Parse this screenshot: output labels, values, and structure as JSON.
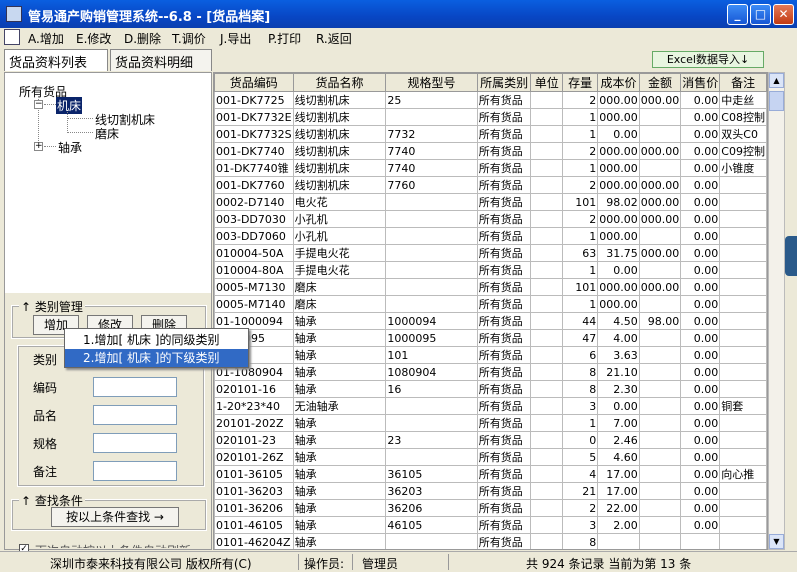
{
  "window": {
    "title": "管易通产购销管理系统--6.8 - [货品档案]",
    "min": "_",
    "max": "□",
    "close": "✕"
  },
  "menu": [
    "A.增加",
    "E.修改",
    "D.删除",
    "T.调价",
    "J.导出",
    "P.打印",
    "R.返回"
  ],
  "tabs": [
    "货品资料列表",
    "货品资料明细"
  ],
  "excel_button": "Excel数据导入↓",
  "tree": {
    "root": "所有货品",
    "nodes": [
      "机床",
      "线切割机床",
      "磨床",
      "轴承"
    ]
  },
  "category": {
    "title": "类别管理",
    "add": "增加",
    "edit": "修改",
    "delete": "删除"
  },
  "popup": [
    "1.增加[ 机床 ]的同级类别",
    "2.增加[ 机床 ]的下级类别"
  ],
  "form": {
    "labels": [
      "类别",
      "编码",
      "品名",
      "规格",
      "备注"
    ]
  },
  "search": {
    "title": "查找条件",
    "button": "按以上条件查找 →",
    "checkbox_label": "下次自动按以上条件自动刷新"
  },
  "table": {
    "headers": [
      "货品编码",
      "货品名称",
      "规格型号",
      "所属类别",
      "单位",
      "存量",
      "成本价",
      "金额",
      "消售价",
      "备注"
    ],
    "rows": [
      [
        "001-DK7725",
        "线切割机床",
        "25",
        "所有货品",
        "",
        "2",
        "000.00",
        "000.00",
        "0.00",
        "中走丝"
      ],
      [
        "001-DK7732E",
        "线切割机床",
        "",
        "所有货品",
        "",
        "1",
        "000.00",
        "",
        "0.00",
        "C08控制"
      ],
      [
        "001-DK7732S",
        "线切割机床",
        "7732",
        "所有货品",
        "",
        "1",
        "0.00",
        "",
        "0.00",
        "双头C0"
      ],
      [
        "001-DK7740",
        "线切割机床",
        "7740",
        "所有货品",
        "",
        "2",
        "000.00",
        "000.00",
        "0.00",
        "C09控制"
      ],
      [
        "01-DK7740锥",
        "线切割机床",
        "7740",
        "所有货品",
        "",
        "1",
        "000.00",
        "",
        "0.00",
        "小锥度"
      ],
      [
        "001-DK7760",
        "线切割机床",
        "7760",
        "所有货品",
        "",
        "2",
        "000.00",
        "000.00",
        "0.00",
        ""
      ],
      [
        "0002-D7140",
        "电火花",
        "",
        "所有货品",
        "",
        "101",
        "98.02",
        "000.00",
        "0.00",
        ""
      ],
      [
        "003-DD7030",
        "小孔机",
        "",
        "所有货品",
        "",
        "2",
        "000.00",
        "000.00",
        "0.00",
        ""
      ],
      [
        "003-DD7060",
        "小孔机",
        "",
        "所有货品",
        "",
        "1",
        "000.00",
        "",
        "0.00",
        ""
      ],
      [
        "010004-50A",
        "手提电火花",
        "",
        "所有货品",
        "",
        "63",
        "31.75",
        "000.00",
        "0.00",
        ""
      ],
      [
        "010004-80A",
        "手提电火花",
        "",
        "所有货品",
        "",
        "1",
        "0.00",
        "",
        "0.00",
        ""
      ],
      [
        "0005-M7130",
        "磨床",
        "",
        "所有货品",
        "",
        "101",
        "000.00",
        "000.00",
        "0.00",
        ""
      ],
      [
        "0005-M7140",
        "磨床",
        "",
        "所有货品",
        "",
        "1",
        "000.00",
        "",
        "0.00",
        ""
      ],
      [
        "01-1000094",
        "轴承",
        "1000094",
        "所有货品",
        "",
        "44",
        "4.50",
        "98.00",
        "0.00",
        ""
      ],
      [
        "1000095",
        "轴承",
        "1000095",
        "所有货品",
        "",
        "47",
        "4.00",
        "",
        "0.00",
        ""
      ],
      [
        "-101",
        "轴承",
        "101",
        "所有货品",
        "",
        "6",
        "3.63",
        "",
        "0.00",
        ""
      ],
      [
        "01-1080904",
        "轴承",
        "1080904",
        "所有货品",
        "",
        "8",
        "21.10",
        "",
        "0.00",
        ""
      ],
      [
        "020101-16",
        "轴承",
        "16",
        "所有货品",
        "",
        "8",
        "2.30",
        "",
        "0.00",
        ""
      ],
      [
        "1-20*23*40",
        "无油轴承",
        "",
        "所有货品",
        "",
        "3",
        "0.00",
        "",
        "0.00",
        "铜套"
      ],
      [
        "20101-202Z",
        "轴承",
        "",
        "所有货品",
        "",
        "1",
        "7.00",
        "",
        "0.00",
        ""
      ],
      [
        "020101-23",
        "轴承",
        "23",
        "所有货品",
        "",
        "0",
        "2.46",
        "",
        "0.00",
        ""
      ],
      [
        "020101-26Z",
        "轴承",
        "",
        "所有货品",
        "",
        "5",
        "4.60",
        "",
        "0.00",
        ""
      ],
      [
        "0101-36105",
        "轴承",
        "36105",
        "所有货品",
        "",
        "4",
        "17.00",
        "",
        "0.00",
        "向心推"
      ],
      [
        "0101-36203",
        "轴承",
        "36203",
        "所有货品",
        "",
        "21",
        "17.00",
        "",
        "0.00",
        ""
      ],
      [
        "0101-36206",
        "轴承",
        "36206",
        "所有货品",
        "",
        "2",
        "22.00",
        "",
        "0.00",
        ""
      ],
      [
        "0101-46105",
        "轴承",
        "46105",
        "所有货品",
        "",
        "3",
        "2.00",
        "",
        "0.00",
        ""
      ],
      [
        "0101-46204Z",
        "轴承",
        "",
        "所有货品",
        "",
        "8",
        "",
        "",
        "",
        ""
      ]
    ]
  },
  "status": {
    "company": "深圳市泰来科技有限公司 版权所有(C)",
    "operator_label": "操作员:",
    "operator": "管理员",
    "records": "共 924 条记录 当前为第 13 条"
  }
}
